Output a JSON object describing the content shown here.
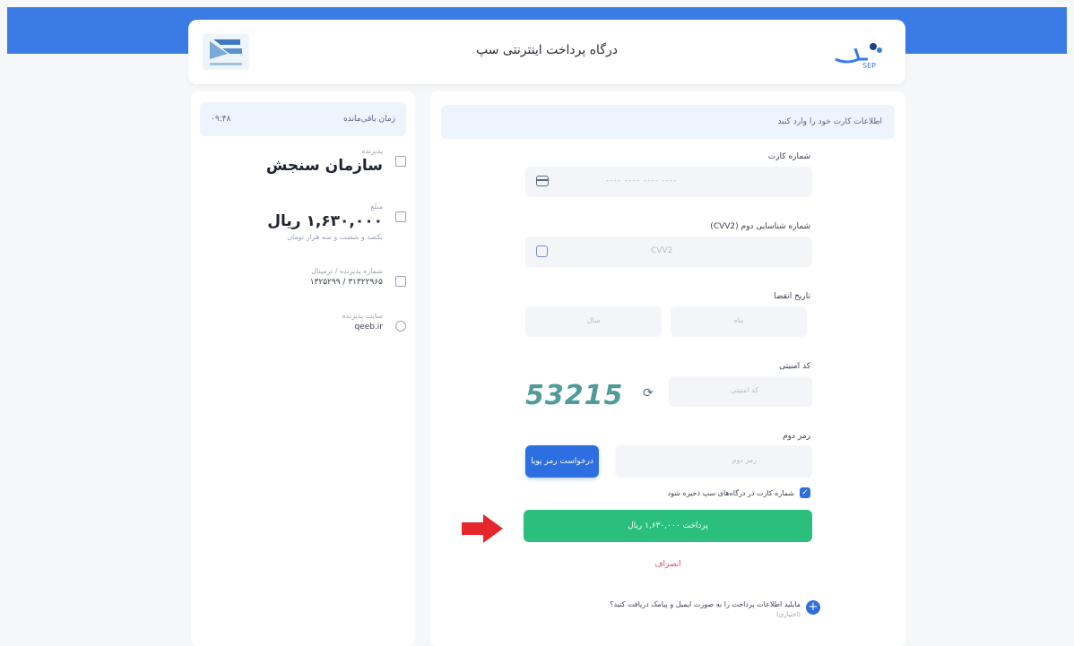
{
  "header": {
    "title": "درگاه پرداخت اینترنتی سپ",
    "brand_logo_text": "سپ SEP"
  },
  "summary": {
    "timer_label": "زمان باقی‌مانده",
    "timer_value": "۰۹:۴۸",
    "merchant_label": "پذیرنده",
    "merchant_name": "سازمان سنجش",
    "amount_label": "مبلغ",
    "amount_value": "۱,۶۳۰,۰۰۰ ریال",
    "amount_words": "یکصد و شصت و سه هزار تومان",
    "terminal_label": "شماره پذیرنده / ترمینال",
    "terminal_value": "۳۱۳۲۲۹۶۵ / ۱۳۲۵۲۹۹",
    "website_label": "سایت پذیرنده",
    "website_value": "qeeb.ir"
  },
  "form": {
    "heading": "اطلاعات کارت خود را وارد کنید",
    "card_number_label": "شماره کارت",
    "card_number_placeholder": "---- ---- ---- ----",
    "cvv2_label": "شماره شناسایی دوم (CVV2)",
    "cvv2_placeholder": "CVV2",
    "expiry_label": "تاریخ انقضا",
    "month_placeholder": "ماه",
    "year_placeholder": "سال",
    "captcha_label": "کد امنیتی",
    "captcha_value": "53215",
    "captcha_placeholder": "کد امنیتی",
    "otp_label": "رمز دوم",
    "otp_placeholder": "رمز دوم",
    "otp_button": "درخواست رمز پویا",
    "save_card_text": "شماره کارت در درگاه‌های سپ ذخیره شود",
    "pay_button": "پرداخت ۱,۶۳۰,۰۰۰ ریال",
    "cancel_link": "انصراف",
    "receipt_question": "مایلید اطلاعات پرداخت را به صورت ایمیل و پیامک دریافت کنید؟",
    "receipt_optional": "(اختیاری)"
  },
  "colors": {
    "band": "#3a7be6",
    "primary": "#2d6fe0",
    "pay": "#2bbf7e",
    "cancel": "#e0506a",
    "captcha": "#4f9b9a",
    "arrow": "#e5262a"
  }
}
